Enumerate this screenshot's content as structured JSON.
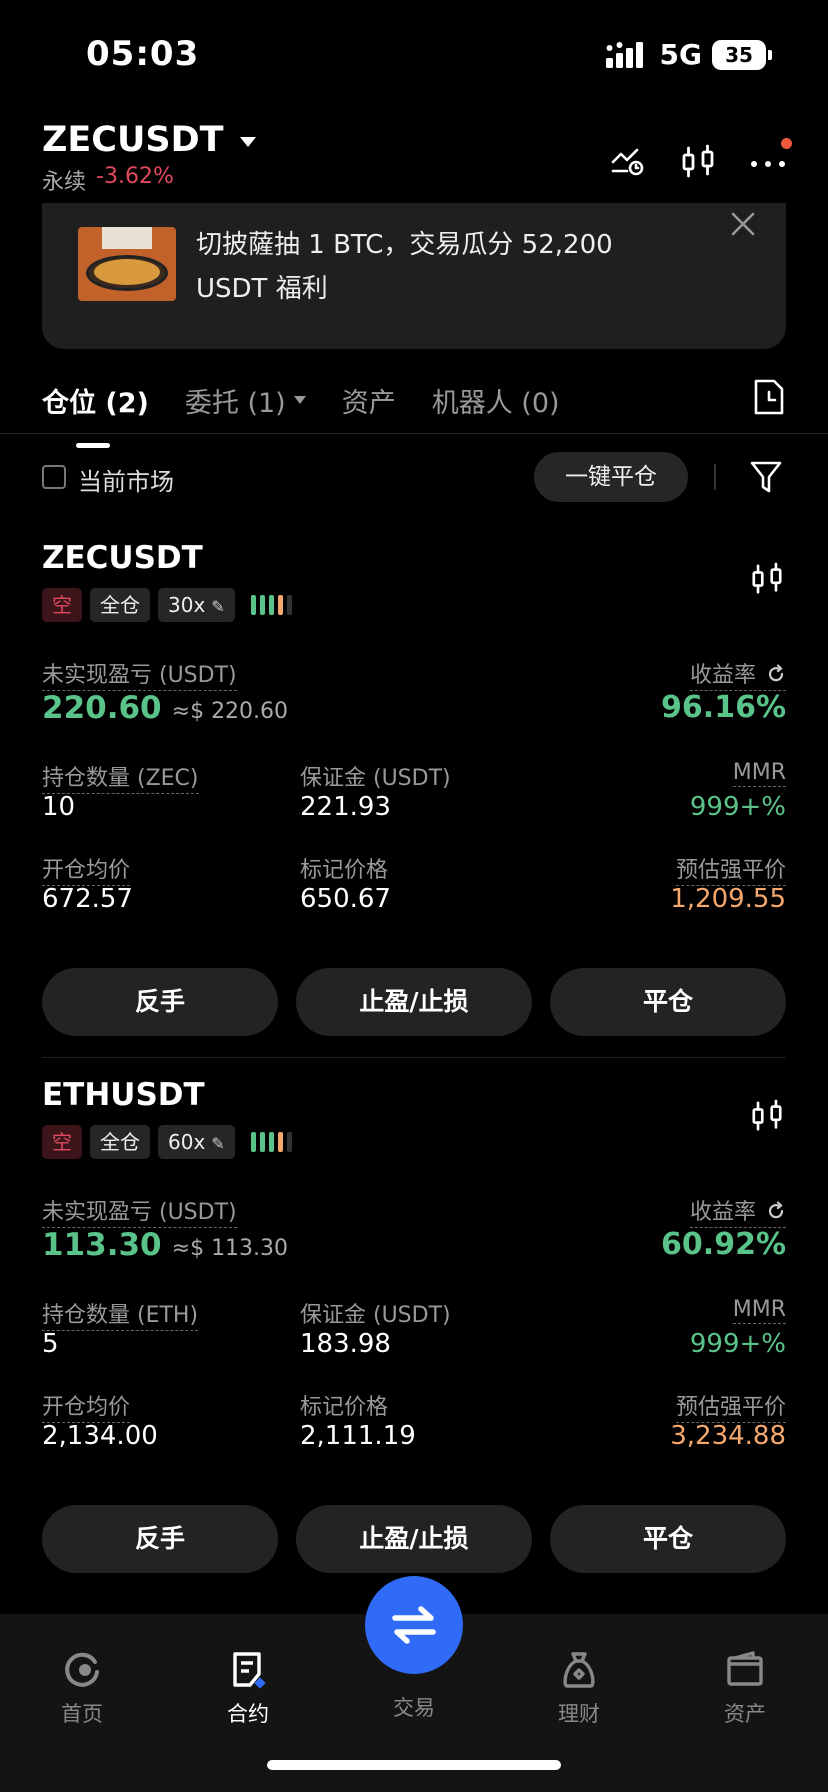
{
  "status_bar": {
    "time": "05:03",
    "network": "5G",
    "battery": "35"
  },
  "header": {
    "pair": "ZECUSDT",
    "type": "永续",
    "change": "-3.62%"
  },
  "banner": {
    "text": "切披薩抽 1 BTC，交易瓜分 52,200 USDT 福利"
  },
  "tabs": [
    {
      "label": "仓位 (2)"
    },
    {
      "label": "委托 (1)"
    },
    {
      "label": "资产"
    },
    {
      "label": "机器人 (0)"
    }
  ],
  "filter": {
    "current_market_label": "当前市场",
    "close_all_label": "一键平仓"
  },
  "labels": {
    "unrealized_pnl": "未实现盈亏 (USDT)",
    "roi": "收益率",
    "margin": "保证金 (USDT)",
    "mmr": "MMR",
    "entry_price": "开仓均价",
    "mark_price": "标记价格",
    "liq_price": "预估强平价"
  },
  "positions": [
    {
      "symbol": "ZECUSDT",
      "side": "空",
      "margin_mode": "全仓",
      "leverage": "30x",
      "pnl": "220.60",
      "pnl_usd": "≈$ 220.60",
      "roi": "96.16%",
      "qty_label": "持仓数量 (ZEC)",
      "qty": "10",
      "margin": "221.93",
      "mmr": "999+%",
      "entry_price": "672.57",
      "mark_price": "650.67",
      "liq_price": "1,209.55"
    },
    {
      "symbol": "ETHUSDT",
      "side": "空",
      "margin_mode": "全仓",
      "leverage": "60x",
      "pnl": "113.30",
      "pnl_usd": "≈$ 113.30",
      "roi": "60.92%",
      "qty_label": "持仓数量 (ETH)",
      "qty": "5",
      "margin": "183.98",
      "mmr": "999+%",
      "entry_price": "2,134.00",
      "mark_price": "2,111.19",
      "liq_price": "3,234.88"
    }
  ],
  "actions": {
    "reverse": "反手",
    "tpsl": "止盈/止损",
    "close": "平仓"
  },
  "nav": [
    {
      "label": "首页",
      "icon": "home-icon"
    },
    {
      "label": "合约",
      "icon": "futures-icon"
    },
    {
      "label": "交易",
      "icon": "swap-icon"
    },
    {
      "label": "理财",
      "icon": "earn-icon"
    },
    {
      "label": "资产",
      "icon": "wallet-icon"
    }
  ],
  "colors": {
    "green": "#5ac38a",
    "red": "#e0495e",
    "orange": "#f5a86d",
    "accent": "#2f6bf6"
  }
}
